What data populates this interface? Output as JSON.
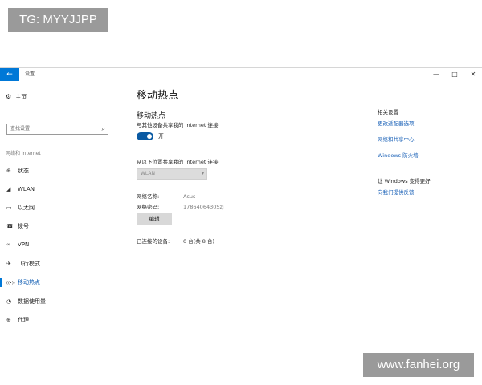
{
  "watermarks": {
    "top_left": "TG: MYYJJPP",
    "bottom_right": "www.fanhei.org"
  },
  "window": {
    "title": "设置",
    "back_glyph": "←",
    "controls": {
      "minimize": "—",
      "maximize": "□",
      "close": "✕"
    }
  },
  "sidebar": {
    "home_label": "主页",
    "home_icon": "gear-icon",
    "search_placeholder": "查找设置",
    "search_icon": "search-icon",
    "section_label": "网络和 Internet",
    "items": [
      {
        "label": "状态",
        "icon": "globe-icon",
        "glyph": "⊕"
      },
      {
        "label": "WLAN",
        "icon": "wifi-icon",
        "glyph": "◢"
      },
      {
        "label": "以太网",
        "icon": "ethernet-icon",
        "glyph": "▭"
      },
      {
        "label": "拨号",
        "icon": "dialup-icon",
        "glyph": "☎"
      },
      {
        "label": "VPN",
        "icon": "vpn-icon",
        "glyph": "∞"
      },
      {
        "label": "飞行模式",
        "icon": "airplane-icon",
        "glyph": "✈"
      },
      {
        "label": "移动热点",
        "icon": "hotspot-icon",
        "glyph": "((•))",
        "active": true
      },
      {
        "label": "数据使用量",
        "icon": "data-usage-icon",
        "glyph": "◔"
      },
      {
        "label": "代理",
        "icon": "proxy-icon",
        "glyph": "⊕"
      }
    ]
  },
  "main": {
    "title": "移动热点",
    "section_heading": "移动热点",
    "share_description": "与其他设备共享我的 Internet 连接",
    "toggle_label": "开",
    "toggle_on": true,
    "share_from_label": "从以下位置共享我的 Internet 连接",
    "share_from_value": "WLAN",
    "network_name_label": "网络名称:",
    "network_name_value": "Asus",
    "network_password_label": "网络密码:",
    "network_password_value": "1786406430Szj",
    "edit_button_label": "编辑",
    "connected_devices_label": "已连接的设备:",
    "connected_devices_value": "0 台(共 8 台)"
  },
  "related": {
    "heading": "相关设置",
    "links": [
      "更改适配器选项",
      "网络和共享中心",
      "Windows 防火墙"
    ],
    "feedback_heading": "让 Windows 变得更好",
    "feedback_link": "向我们提供反馈"
  },
  "colors": {
    "accent": "#0078d7",
    "link": "#1d63b8",
    "toggle": "#0a5aa3"
  }
}
